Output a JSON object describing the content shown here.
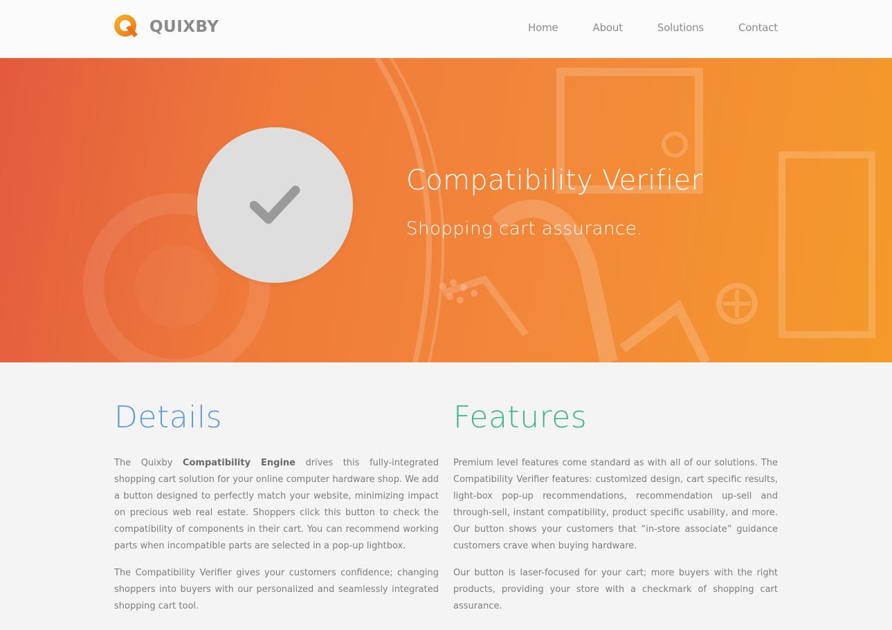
{
  "brand": {
    "name": "QUIXBY",
    "color": "#f0a020"
  },
  "nav": {
    "items": [
      {
        "label": "Home"
      },
      {
        "label": "About"
      },
      {
        "label": "Solutions"
      },
      {
        "label": "Contact"
      }
    ]
  },
  "hero": {
    "icon": "checkmark-icon",
    "title": "Compatibility Verifier",
    "subtitle": "Shopping cart assurance.",
    "colors": {
      "gradient_start": "#e35a3e",
      "gradient_end": "#f59a2a"
    }
  },
  "details": {
    "heading": "Details",
    "heading_color": "#5a9bd8",
    "p1_before": "The Quixby ",
    "p1_bold": "Compatibility Engine",
    "p1_after": " drives this fully-integrated shopping cart solution for your online computer hardware shop. We add a button designed to perfectly match your website, minimizing impact on precious web real estate. Shoppers click this button to check the compatibility of components in their cart. You can recommend working parts when incompatible parts are selected in a pop-up lightbox.",
    "p2": "The Compatibility Verifier gives your customers confidence; changing shoppers into buyers with our personalized and seamlessly integrated shopping cart tool."
  },
  "features": {
    "heading": "Features",
    "heading_color": "#3bb48f",
    "p1": "Premium level features come standard as with all of our solutions. The Compatibility Verifier features: customized design, cart specific results, light-box pop-up recommendations, recommendation up-sell and through-sell, instant compatibility, product specific usability, and more. Our button shows your customers that “in-store associate” guidance customers crave when buying hardware.",
    "p2": "Our button is laser-focused for your cart; more buyers with the right products, providing your store with a checkmark of shopping cart assurance."
  }
}
